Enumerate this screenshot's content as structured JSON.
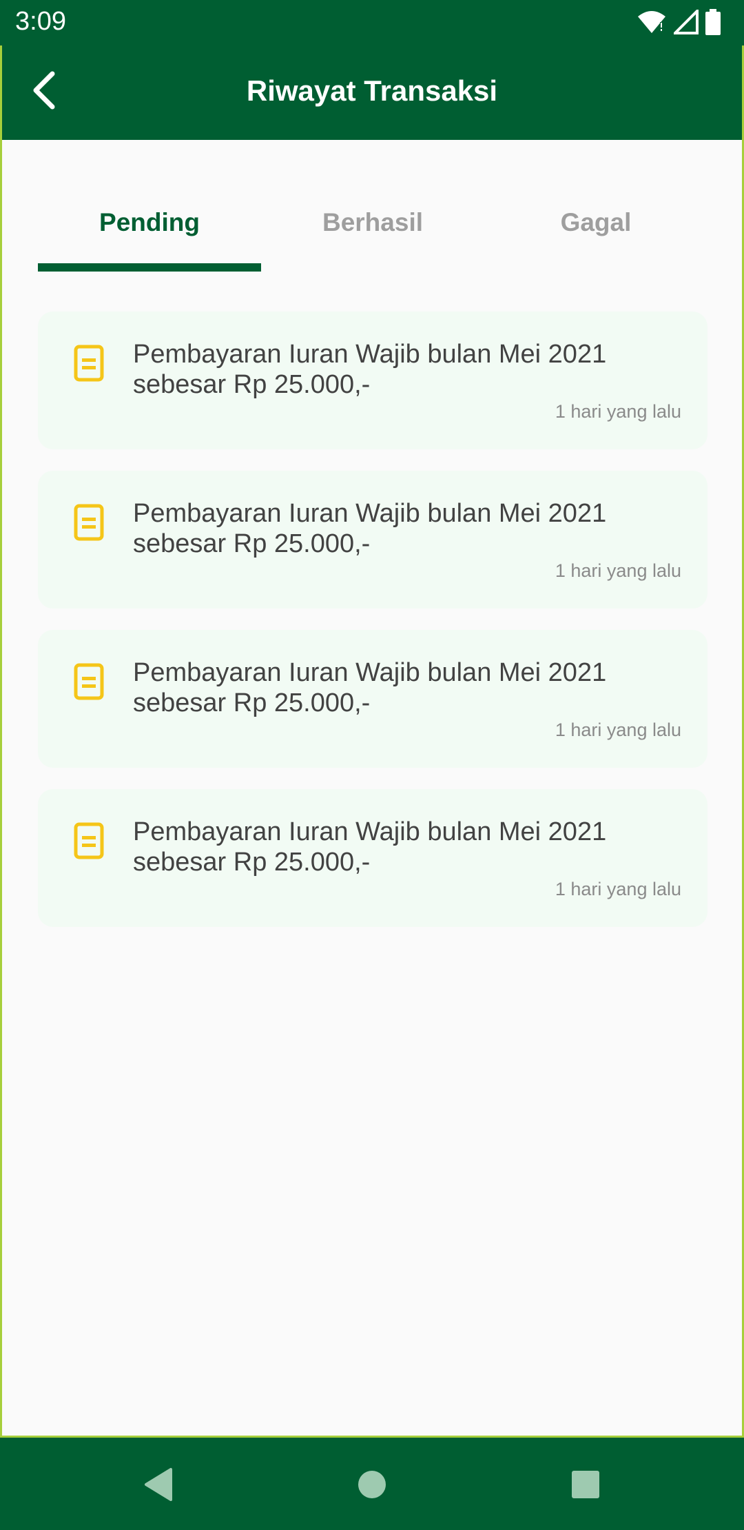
{
  "status_bar": {
    "time": "3:09",
    "icons": [
      "wifi-icon",
      "signal-icon",
      "battery-icon"
    ]
  },
  "app_bar": {
    "title": "Riwayat Transaksi",
    "back_icon": "chevron-left-icon"
  },
  "tabs": [
    {
      "label": "Pending",
      "active": true
    },
    {
      "label": "Berhasil",
      "active": false
    },
    {
      "label": "Gagal",
      "active": false
    }
  ],
  "transactions": [
    {
      "line1": "Pembayaran Iuran Wajib bulan Mei 2021",
      "line2": "sebesar Rp 25.000,-",
      "time": "1 hari yang lalu",
      "icon": "document-icon"
    },
    {
      "line1": "Pembayaran Iuran Wajib bulan Mei 2021",
      "line2": "sebesar Rp 25.000,-",
      "time": "1 hari yang lalu",
      "icon": "document-icon"
    },
    {
      "line1": "Pembayaran Iuran Wajib bulan Mei 2021",
      "line2": "sebesar Rp 25.000,-",
      "time": "1 hari yang lalu",
      "icon": "document-icon"
    },
    {
      "line1": "Pembayaran Iuran Wajib bulan Mei 2021",
      "line2": "sebesar Rp 25.000,-",
      "time": "1 hari yang lalu",
      "icon": "document-icon"
    }
  ],
  "nav_bar": {
    "icons": [
      "back-triangle-icon",
      "home-circle-icon",
      "recents-square-icon"
    ]
  },
  "colors": {
    "primary": "#005e32",
    "accent_border": "#a6cf3b",
    "card_bg": "#f2fbf4",
    "icon_yellow": "#f5c518",
    "inactive_tab": "#9e9e9e"
  }
}
